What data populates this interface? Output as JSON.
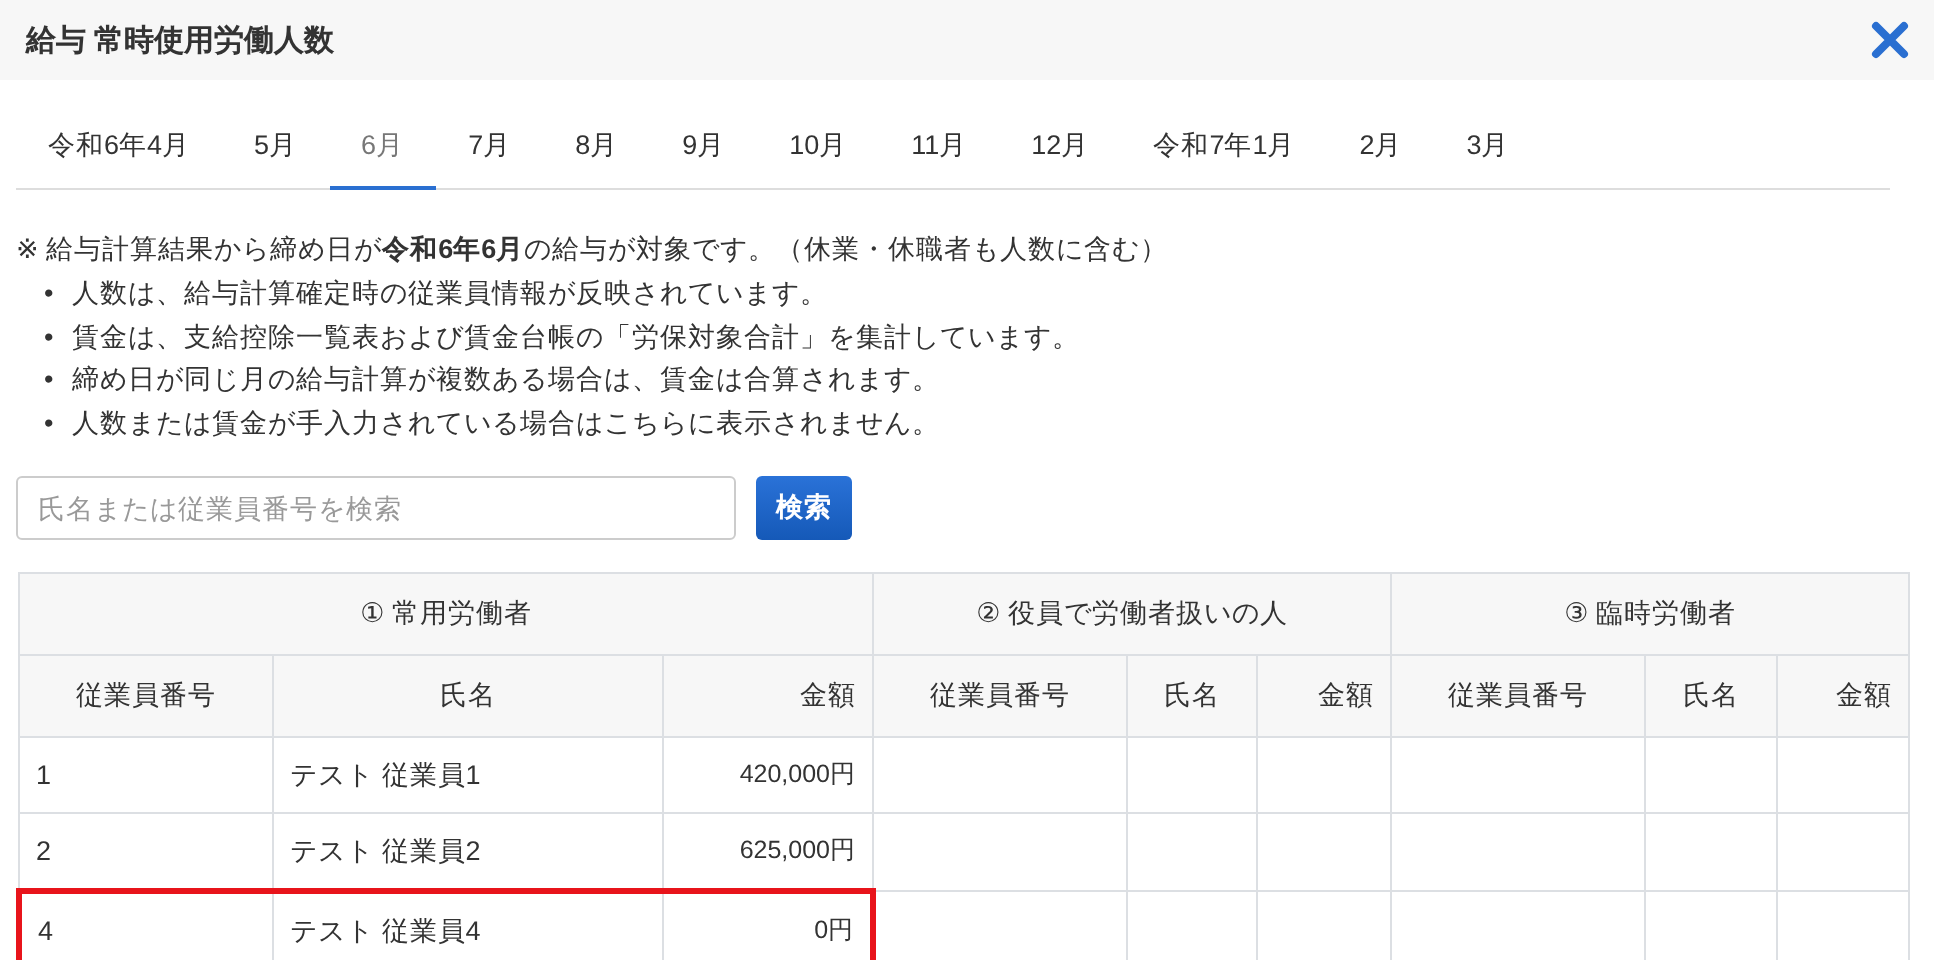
{
  "window": {
    "title": "給与 常時使用労働人数"
  },
  "tabs": [
    {
      "label": "令和6年4月",
      "selected": false
    },
    {
      "label": "5月",
      "selected": false
    },
    {
      "label": "6月",
      "selected": true
    },
    {
      "label": "7月",
      "selected": false
    },
    {
      "label": "8月",
      "selected": false
    },
    {
      "label": "9月",
      "selected": false
    },
    {
      "label": "10月",
      "selected": false
    },
    {
      "label": "11月",
      "selected": false
    },
    {
      "label": "12月",
      "selected": false
    },
    {
      "label": "令和7年1月",
      "selected": false
    },
    {
      "label": "2月",
      "selected": false
    },
    {
      "label": "3月",
      "selected": false
    }
  ],
  "notice": {
    "lead": "※ 給与計算結果から締め日が**令和6年6月**の給与が対象です。（休業・休職者も人数に含む）",
    "bullet_marker": "•",
    "bullets": [
      "人数は、給与計算確定時の従業員情報が反映されています。",
      "賃金は、支給控除一覧表および賃金台帳の「労保対象合計」を集計しています。",
      "締め日が同じ月の給与計算が複数ある場合は、賃金は合算されます。",
      "人数または賃金が手入力されている場合はこちらに表示されません。"
    ]
  },
  "search": {
    "placeholder": "氏名または従業員番号を検索",
    "button": "検索"
  },
  "table": {
    "groups": [
      "① 常用労働者",
      "② 役員で労働者扱いの人",
      "③ 臨時労働者"
    ],
    "columns": [
      "従業員番号",
      "氏名",
      "金額",
      "従業員番号",
      "氏名",
      "金額",
      "従業員番号",
      "氏名",
      "金額"
    ],
    "rows": [
      {
        "cells": [
          "1",
          "テスト 従業員1",
          "420,000円"
        ],
        "highlighted": false
      },
      {
        "cells": [
          "2",
          "テスト 従業員2",
          "625,000円"
        ],
        "highlighted": false
      },
      {
        "cells": [
          "4",
          "テスト 従業員4",
          "0円"
        ],
        "highlighted": true
      }
    ]
  }
}
